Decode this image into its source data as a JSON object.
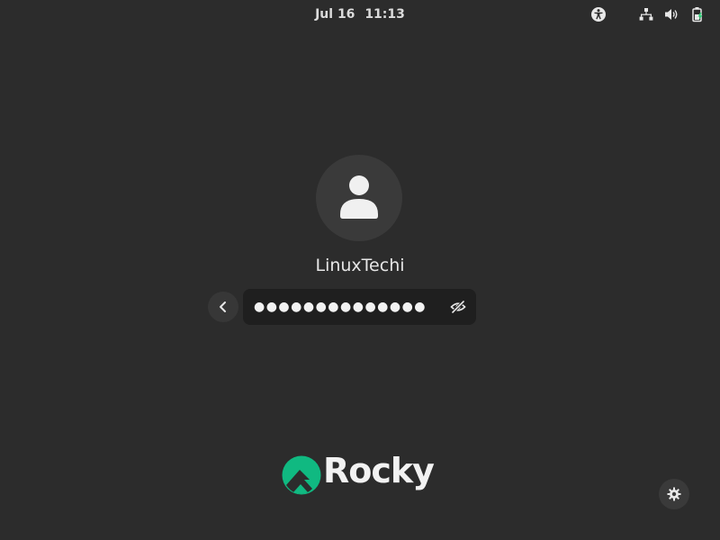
{
  "topbar": {
    "date": "Jul 16",
    "time": "11:13",
    "tray": [
      "accessibility-icon",
      "network-icon",
      "volume-icon",
      "battery-icon"
    ]
  },
  "login": {
    "username": "LinuxTechi",
    "password_masked": "●●●●●●●●●●●●●●"
  },
  "branding": {
    "logo_text": "Rocky",
    "accent": "#10b981"
  },
  "colors": {
    "background": "#2c2c2c",
    "avatar_bg": "#3a3a3a",
    "field_bg": "#1f1f1f"
  }
}
